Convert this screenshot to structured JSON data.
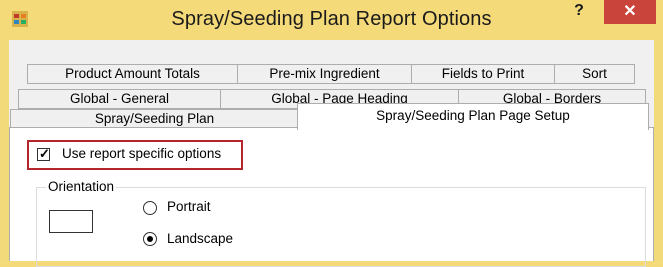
{
  "window": {
    "title": "Spray/Seeding Plan Report Options",
    "help_label": "?",
    "close_label": "✕"
  },
  "tabs": {
    "row1": [
      "Product Amount Totals",
      "Pre-mix Ingredient",
      "Fields to Print",
      "Sort"
    ],
    "row2": [
      "Global - General",
      "Global - Page Heading",
      "Global - Borders"
    ],
    "row3": [
      "Spray/Seeding Plan",
      "Spray/Seeding Plan Page Setup"
    ],
    "selected": "Spray/Seeding Plan Page Setup"
  },
  "options": {
    "use_report_specific_label": "Use report specific options",
    "use_report_specific_checked": true,
    "highlight_color": "#b3262c"
  },
  "orientation": {
    "legend": "Orientation",
    "options": [
      "Portrait",
      "Landscape"
    ],
    "selected": "Landscape"
  }
}
